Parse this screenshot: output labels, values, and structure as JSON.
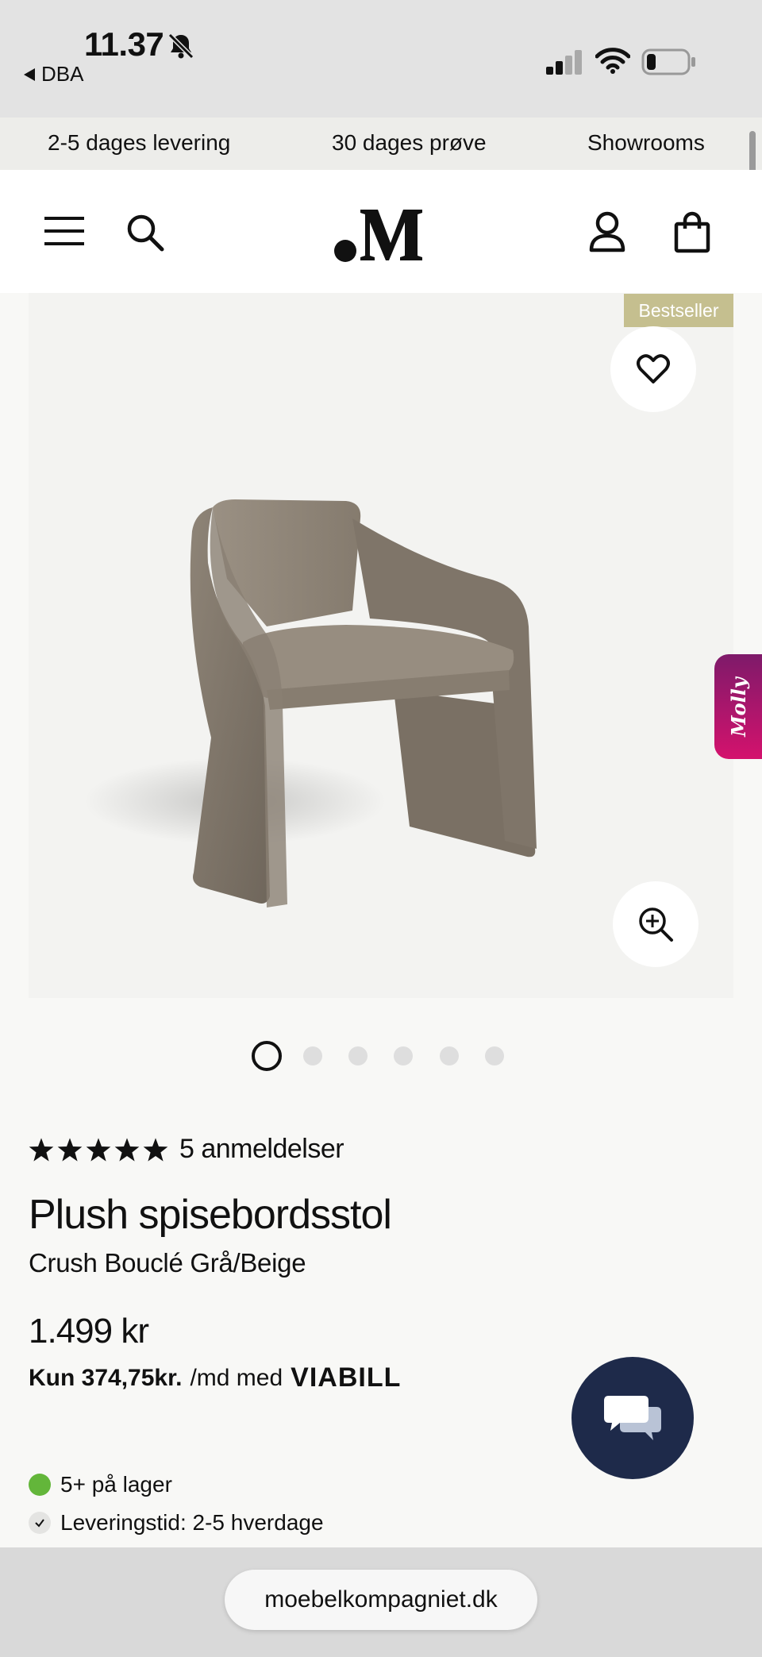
{
  "status_bar": {
    "time": "11.37",
    "back_app": "DBA"
  },
  "promo_strip": {
    "items": [
      "2-5 dages levering",
      "30 dages prøve",
      "Showrooms"
    ]
  },
  "product": {
    "badge": "Bestseller",
    "image_count": 6,
    "active_image": 1,
    "rating": 5,
    "review_count": "5 anmeldelser",
    "title": "Plush spisebordsstol",
    "variant": "Crush Bouclé Grå/Beige",
    "price": "1.499 kr",
    "financing_amount": "Kun 374,75kr.",
    "financing_text": "/md med",
    "financing_provider": "VIABILL",
    "stock": "5+ på lager",
    "delivery": "Leveringstid: 2-5 hverdage"
  },
  "side_widget": {
    "label": "Molly"
  },
  "browser": {
    "url": "moebelkompagniet.dk"
  },
  "colors": {
    "badge": "#c5bf8f",
    "stock_green": "#63b63a",
    "chat_button": "#1e2a4a",
    "molly_gradient_start": "#7e1a6a",
    "molly_gradient_end": "#d4126d"
  }
}
